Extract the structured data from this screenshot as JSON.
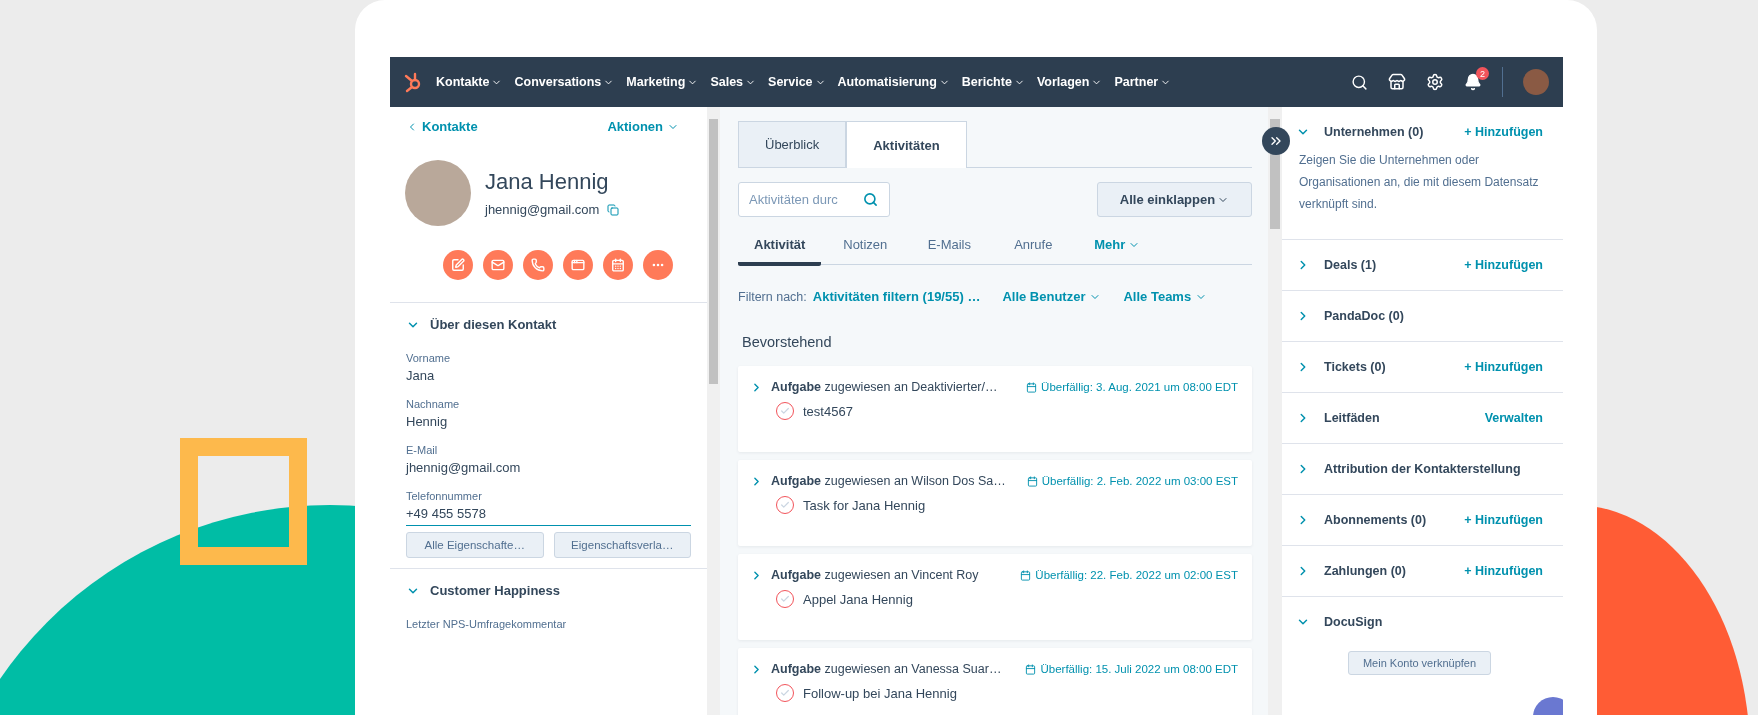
{
  "nav": {
    "items": [
      "Kontakte",
      "Conversations",
      "Marketing",
      "Sales",
      "Service",
      "Automatisierung",
      "Berichte",
      "Vorlagen",
      "Partner"
    ],
    "notification_count": "2"
  },
  "contact": {
    "back_link": "Kontakte",
    "actions": "Aktionen",
    "name": "Jana Hennig",
    "email": "jhennig@gmail.com"
  },
  "about_section": {
    "title": "Über diesen Kontakt",
    "expanded": true,
    "fields": [
      {
        "label": "Vorname",
        "value": "Jana",
        "focused": false
      },
      {
        "label": "Nachname",
        "value": "Hennig",
        "focused": false
      },
      {
        "label": "E-Mail",
        "value": "jhennig@gmail.com",
        "focused": false
      },
      {
        "label": "Telefonnummer",
        "value": "+49 455 5578",
        "focused": true
      }
    ],
    "buttons": [
      "Alle Eigenschafte…",
      "Eigenschaftsverla…"
    ]
  },
  "happiness_section": {
    "title": "Customer Happiness",
    "expanded": true,
    "field_label": "Letzter NPS-Umfragekommentar"
  },
  "tabs": [
    {
      "label": "Überblick",
      "selected": false
    },
    {
      "label": "Aktivitäten",
      "selected": true
    }
  ],
  "activity_search": {
    "placeholder": "Aktivitäten durc"
  },
  "collapse_button": "Alle einklappen",
  "activity_tabs": [
    {
      "label": "Aktivität",
      "kind": "tab",
      "selected": true
    },
    {
      "label": "Notizen",
      "kind": "tab",
      "selected": false
    },
    {
      "label": "E-Mails",
      "kind": "tab",
      "selected": false
    },
    {
      "label": "Anrufe",
      "kind": "tab",
      "selected": false
    },
    {
      "label": "Mehr",
      "kind": "menu",
      "selected": false
    }
  ],
  "filters": {
    "label": "Filtern nach:",
    "items": [
      {
        "label": "Aktivitäten filtern (19/55) …",
        "kind": "link"
      },
      {
        "label": "Alle Benutzer",
        "kind": "dropdown"
      },
      {
        "label": "Alle Teams",
        "kind": "dropdown"
      }
    ]
  },
  "upcoming": {
    "title": "Bevorstehend",
    "tasks": [
      {
        "summary": "**Aufgabe** zugewiesen an Deaktivierter/…",
        "due": "Überfällig: 3. Aug. 2021 um 08:00 EDT",
        "title": "test4567",
        "completed": false
      },
      {
        "summary": "**Aufgabe** zugewiesen an Wilson Dos Sa…",
        "due": "Überfällig: 2. Feb. 2022 um 03:00 EST",
        "title": "Task for Jana Hennig",
        "completed": false
      },
      {
        "summary": "**Aufgabe** zugewiesen an Vincent Roy",
        "due": "Überfällig: 22. Feb. 2022 um 02:00 EST",
        "title": "Appel Jana Hennig",
        "completed": false
      },
      {
        "summary": "**Aufgabe** zugewiesen an Vanessa Suar…",
        "due": "Überfällig: 15. Juli 2022 um 08:00 EDT",
        "title": "Follow-up bei Jana Hennig",
        "completed": false
      }
    ]
  },
  "sidebar_sections": [
    {
      "title": "Unternehmen (0)",
      "expanded": true,
      "action": "+ Hinzufügen",
      "description": "Zeigen Sie die Unternehmen oder Organisationen an, die mit diesem Datensatz verknüpft sind."
    },
    {
      "title": "Deals (1)",
      "expanded": false,
      "action": "+ Hinzufügen"
    },
    {
      "title": "PandaDoc (0)",
      "expanded": false
    },
    {
      "title": "Tickets (0)",
      "expanded": false,
      "action": "+ Hinzufügen"
    },
    {
      "title": "Leitfäden",
      "expanded": false,
      "action": "Verwalten"
    },
    {
      "title": "Attribution der Kontakterstellung",
      "expanded": false
    },
    {
      "title": "Abonnements (0)",
      "expanded": false,
      "action": "+ Hinzufügen"
    },
    {
      "title": "Zahlungen (0)",
      "expanded": false,
      "action": "+ Hinzufügen"
    },
    {
      "title": "DocuSign",
      "expanded": true,
      "button": "Mein Konto verknüpfen"
    }
  ]
}
